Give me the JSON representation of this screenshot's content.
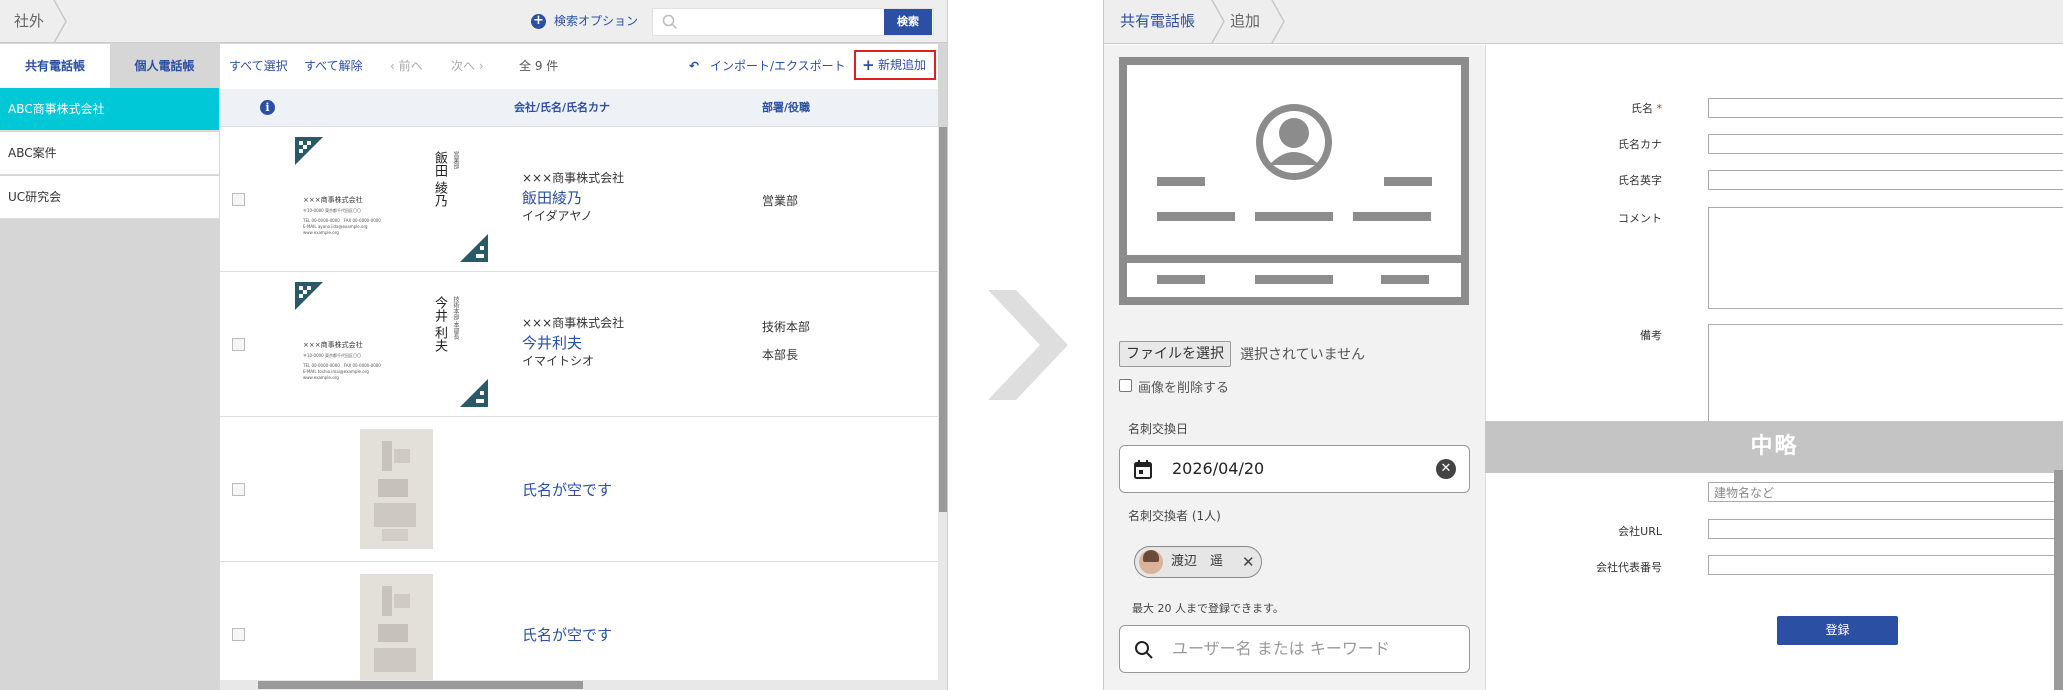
{
  "left": {
    "breadcrumb": "社外",
    "search_option": "検索オプション",
    "search_button": "検索",
    "tabs": [
      "共有電話帳",
      "個人電話帳"
    ],
    "sidebar_items": [
      "ABC商事株式会社",
      "ABC案件",
      "UC研究会"
    ],
    "toolbar": {
      "select_all": "すべて選択",
      "deselect_all": "すべて解除",
      "prev": "前へ",
      "next": "次へ",
      "count": "全 9 件",
      "import_export": "インポート/エクスポート",
      "add_new": "新規追加"
    },
    "table_header": {
      "name_col": "会社/氏名/氏名カナ",
      "dept_col": "部署/役職"
    },
    "rows": [
      {
        "company": "×××商事株式会社",
        "name": "飯田綾乃",
        "kana": "イイダアヤノ",
        "dept": "営業部",
        "role": "",
        "card": {
          "name_vertical": "飯田 綾乃",
          "title_vertical": "営業部",
          "company": "×××商事株式会社",
          "address": "〒10-0000 東京都千代田区〇〇",
          "tel": "TEL 00-0000-0000　FAX 00-0000-0000",
          "mail": "E-MAIL ayano.iida@example.org",
          "web": "www.example.org"
        }
      },
      {
        "company": "×××商事株式会社",
        "name": "今井利夫",
        "kana": "イマイトシオ",
        "dept": "技術本部",
        "role": "本部長",
        "card": {
          "name_vertical": "今井 利夫",
          "title_vertical": "技術本部 本部長",
          "company": "×××商事株式会社",
          "address": "〒10-0000 東京都千代田区〇〇",
          "tel": "TEL 00-0000-0000　FAX 00-0000-0000",
          "mail": "E-MAIL toshio.imai@example.org",
          "web": "www.example.org"
        }
      },
      {
        "name": "氏名が空です"
      },
      {
        "name": "氏名が空です"
      }
    ]
  },
  "right": {
    "breadcrumb": [
      "共有電話帳",
      "追加"
    ],
    "file_button": "ファイルを選択",
    "file_status": "選択されていません",
    "delete_image": "画像を削除する",
    "exchange_date_label": "名刺交換日",
    "exchange_date": "2026/04/20",
    "exchanger_label": "名刺交換者 (1人)",
    "exchanger_name": "渡辺　遥",
    "limit_note": "最大 20 人まで登録できます。",
    "user_search_placeholder": "ユーザー名 または キーワード",
    "fields": {
      "name": "氏名",
      "name_kana": "氏名カナ",
      "name_roman": "氏名英字",
      "comment": "コメント",
      "notes": "備考",
      "building_placeholder": "建物名など",
      "company_url": "会社URL",
      "company_phone": "会社代表番号"
    },
    "required_mark": "*",
    "omitted": "中略",
    "register_button": "登録"
  },
  "colors": {
    "accent": "#2b4fa3",
    "sidebar_selected": "#00c8d7",
    "highlight_box": "#e02020",
    "required": "#e02020"
  }
}
